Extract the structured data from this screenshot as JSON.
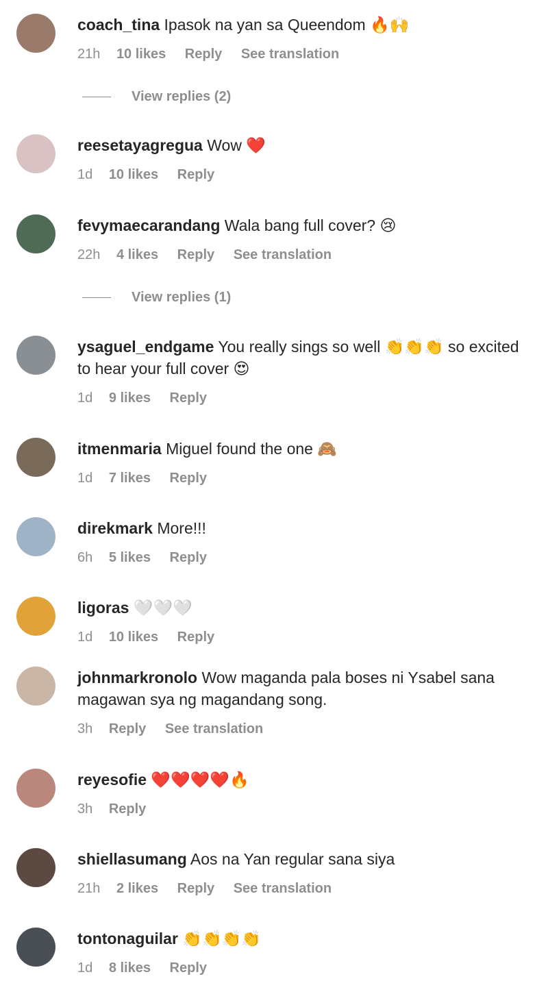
{
  "comments": [
    {
      "username": "coach_tina",
      "text": "Ipasok na yan sa Queendom 🔥🙌",
      "time": "21h",
      "likes": "10 likes",
      "reply": "Reply",
      "translation": "See translation",
      "view_replies": "View replies (2)",
      "avatar_color": "#9a7a6a"
    },
    {
      "username": "reesetayagregua",
      "text": "Wow ❤️",
      "time": "1d",
      "likes": "10 likes",
      "reply": "Reply",
      "avatar_color": "#d9c2c4"
    },
    {
      "username": "fevymaecarandang",
      "text": "Wala bang full cover? 😢",
      "time": "22h",
      "likes": "4 likes",
      "reply": "Reply",
      "translation": "See translation",
      "view_replies": "View replies (1)",
      "avatar_color": "#4f6a55"
    },
    {
      "username": "ysaguel_endgame",
      "text": "You really sings so well 👏👏👏 so excited to hear your full cover 😍",
      "time": "1d",
      "likes": "9 likes",
      "reply": "Reply",
      "avatar_color": "#8a8f94"
    },
    {
      "username": "itmenmaria",
      "text": "Miguel found the one 🙈",
      "time": "1d",
      "likes": "7 likes",
      "reply": "Reply",
      "avatar_color": "#7a6a5a"
    },
    {
      "username": "direkmark",
      "text": "More!!!",
      "time": "6h",
      "likes": "5 likes",
      "reply": "Reply",
      "avatar_color": "#9fb3c6"
    },
    {
      "username": "ligoras",
      "text": "🤍🤍🤍",
      "time": "1d",
      "likes": "10 likes",
      "reply": "Reply",
      "avatar_color": "#e1a23a"
    },
    {
      "username": "johnmarkronolo",
      "text": "Wow maganda pala boses ni Ysabel sana magawan sya ng magandang song.",
      "time": "3h",
      "likes": "",
      "reply": "Reply",
      "translation": "See translation",
      "avatar_color": "#c9b6a6"
    },
    {
      "username": "reyesofie",
      "text": "❤️❤️❤️❤️🔥",
      "time": "3h",
      "likes": "",
      "reply": "Reply",
      "avatar_color": "#b9877c"
    },
    {
      "username": "shiellasumang",
      "text": "Aos na Yan regular sana siya",
      "time": "21h",
      "likes": "2 likes",
      "reply": "Reply",
      "translation": "See translation",
      "avatar_color": "#5c4a42"
    },
    {
      "username": "tontonaguilar",
      "text": "👏👏👏👏",
      "time": "1d",
      "likes": "8 likes",
      "reply": "Reply",
      "avatar_color": "#4a4e55"
    }
  ]
}
